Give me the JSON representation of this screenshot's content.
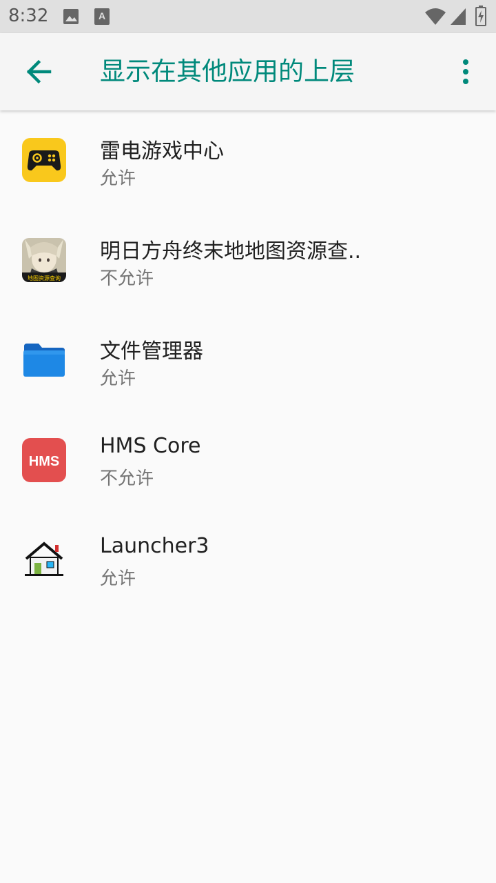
{
  "status_bar": {
    "time": "8:32",
    "icons": [
      "image-icon",
      "text-a-icon",
      "wifi-icon",
      "signal-icon",
      "battery-charging-icon"
    ]
  },
  "app_bar": {
    "title": "显示在其他应用的上层",
    "back_icon": "arrow-back-icon",
    "menu_icon": "more-vert-icon",
    "accent_color": "#00897b"
  },
  "apps": [
    {
      "name": "雷电游戏中心",
      "status": "允许",
      "icon": "gamepad-icon"
    },
    {
      "name": "明日方舟终末地地图资源查..",
      "status": "不允许",
      "icon": "arknights-map-icon",
      "icon_banner_text": "地图资源查询"
    },
    {
      "name": "文件管理器",
      "status": "允许",
      "icon": "folder-icon"
    },
    {
      "name": "HMS Core",
      "status": "不允许",
      "icon": "hms-icon",
      "icon_text": "HMS"
    },
    {
      "name": "Launcher3",
      "status": "允许",
      "icon": "house-icon"
    }
  ]
}
